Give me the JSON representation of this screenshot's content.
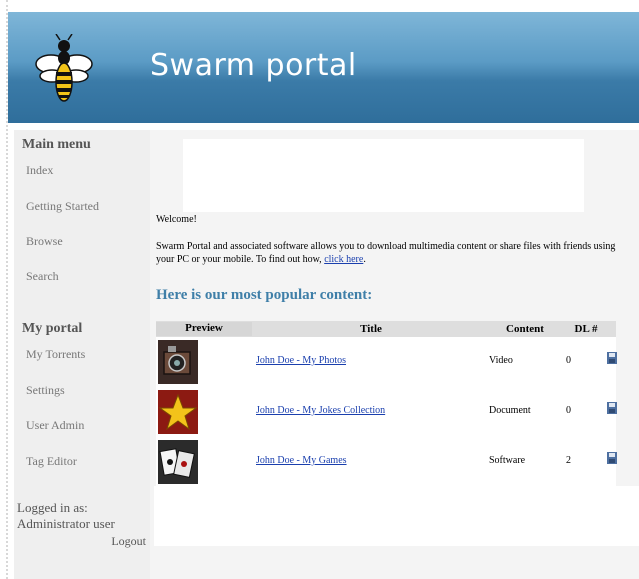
{
  "header": {
    "site_title": "Swarm portal"
  },
  "sidebar": {
    "main_menu_heading": "Main menu",
    "main_items": [
      "Index",
      "Getting Started",
      "Browse",
      "Search"
    ],
    "portal_heading": "My portal",
    "portal_items": [
      "My Torrents",
      "Settings",
      "User Admin",
      "Tag Editor"
    ],
    "logged_in_label": "Logged in as:",
    "user_name": "Administrator user",
    "logout": "Logout"
  },
  "main": {
    "welcome": "Welcome!",
    "intro": "Swarm Portal and associated software allows you to download multimedia content or share files with friends using your PC or your mobile. To find out how,",
    "intro_link": "click here",
    "intro_end": ".",
    "popular_heading": "Here is our most popular content:",
    "table": {
      "columns": [
        "Preview",
        "Title",
        "Content",
        "DL #"
      ],
      "rows": [
        {
          "title": "John Doe - My Photos",
          "content": "Video",
          "dl": "0",
          "thumb": "camera-thumbnail"
        },
        {
          "title": "John Doe - My Jokes Collection",
          "content": "Document",
          "dl": "0",
          "thumb": "star-thumbnail"
        },
        {
          "title": "John Doe - My Games",
          "content": "Software",
          "dl": "2",
          "thumb": "cards-thumbnail"
        }
      ]
    }
  },
  "colors": {
    "header_top": "#7fb6d8",
    "header_bottom": "#2f6e9b",
    "heading_blue": "#3f7fa8",
    "link": "#1a3fae"
  }
}
